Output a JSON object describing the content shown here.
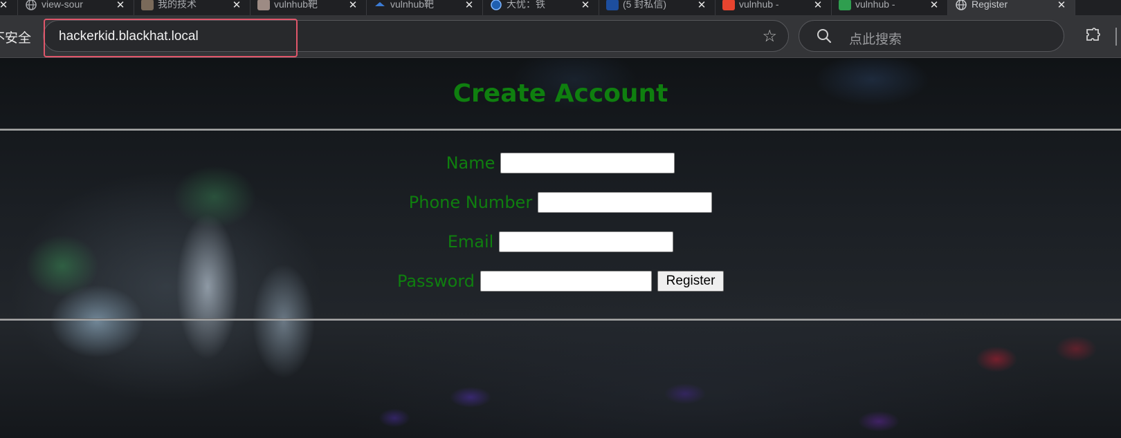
{
  "browser": {
    "tabs": [
      {
        "title": "",
        "favicon": "partial-tab-icon",
        "active": false
      },
      {
        "title": "view-sour",
        "favicon": "globe-icon",
        "active": false
      },
      {
        "title": "我的技术",
        "favicon": "avatar-favicon",
        "active": false
      },
      {
        "title": "vulnhub靶",
        "favicon": "avatar-favicon",
        "active": false
      },
      {
        "title": "vulnhub靶",
        "favicon": "blue-bird-icon",
        "active": false
      },
      {
        "title": "大忧：铁",
        "favicon": "blue-circle-icon",
        "active": false
      },
      {
        "title": "(5 封私信)",
        "favicon": "zhihu-icon",
        "active": false
      },
      {
        "title": "vulnhub -",
        "favicon": "csdn-icon",
        "active": false
      },
      {
        "title": "vulnhub -",
        "favicon": "green-grid-icon",
        "active": false
      },
      {
        "title": "Register",
        "favicon": "globe-icon",
        "active": true
      }
    ],
    "close_glyph": "✕",
    "security_label": "不安全",
    "address": "hackerkid.blackhat.local",
    "search_placeholder": "点此搜索"
  },
  "page": {
    "title": "Create Account",
    "form": {
      "name_label": "Name",
      "phone_label": "Phone Number",
      "email_label": "Email",
      "password_label": "Password",
      "name_value": "",
      "phone_value": "",
      "email_value": "",
      "password_value": "",
      "register_label": "Register"
    }
  },
  "colors": {
    "heading_green": "#0f7f0f",
    "url_highlight": "#e0566a",
    "toolbar_bg": "#343538"
  }
}
